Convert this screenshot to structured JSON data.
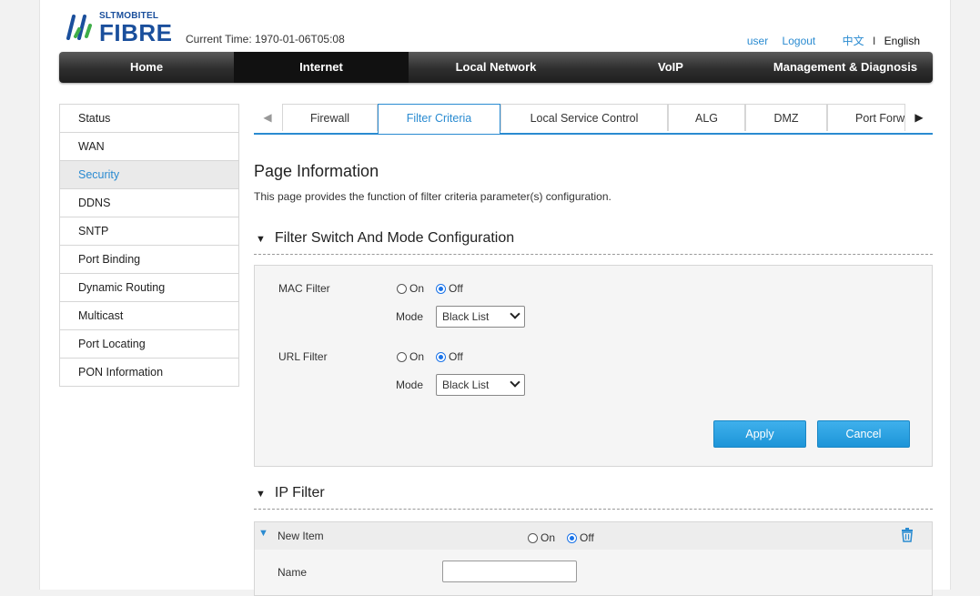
{
  "header": {
    "brand_top": "SLTMOBITEL",
    "brand_main": "FIBRE",
    "current_time": "Current Time: 1970-01-06T05:08",
    "user": "user",
    "logout": "Logout",
    "lang_zh": "中文",
    "lang_sep": "I",
    "lang_en": "English"
  },
  "nav": [
    {
      "label": "Home",
      "active": false
    },
    {
      "label": "Internet",
      "active": true
    },
    {
      "label": "Local Network",
      "active": false
    },
    {
      "label": "VoIP",
      "active": false
    },
    {
      "label": "Management & Diagnosis",
      "active": false
    }
  ],
  "sidebar": {
    "items": [
      {
        "label": "Status"
      },
      {
        "label": "WAN"
      },
      {
        "label": "Security",
        "active": true
      },
      {
        "label": "DDNS"
      },
      {
        "label": "SNTP"
      },
      {
        "label": "Port Binding"
      },
      {
        "label": "Dynamic Routing"
      },
      {
        "label": "Multicast"
      },
      {
        "label": "Port Locating"
      },
      {
        "label": "PON Information"
      }
    ]
  },
  "tabs": [
    {
      "label": "Firewall"
    },
    {
      "label": "Filter Criteria",
      "active": true
    },
    {
      "label": "Local Service Control"
    },
    {
      "label": "ALG"
    },
    {
      "label": "DMZ"
    },
    {
      "label": "Port Forw"
    }
  ],
  "main": {
    "title": "Page Information",
    "description": "This page provides the function of filter criteria parameter(s) configuration.",
    "section1_title": "Filter Switch And Mode Configuration",
    "mac_filter_label": "MAC Filter",
    "url_filter_label": "URL Filter",
    "on_label": "On",
    "off_label": "Off",
    "mode_label": "Mode",
    "mac_mode_value": "Black List",
    "url_mode_value": "Black List",
    "apply_label": "Apply",
    "cancel_label": "Cancel",
    "section2_title": "IP Filter",
    "new_item_label": "New Item",
    "name_label": "Name"
  },
  "colors": {
    "accent": "#2a8bd1",
    "button": "#1d95d8"
  }
}
